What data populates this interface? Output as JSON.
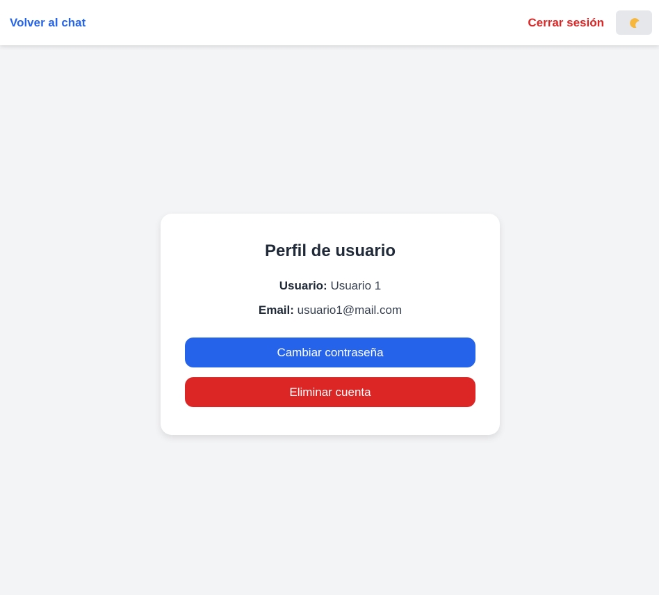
{
  "header": {
    "back_label": "Volver al chat",
    "logout_label": "Cerrar sesión",
    "theme_icon": "moon-icon"
  },
  "profile": {
    "title": "Perfil de usuario",
    "user_label": "Usuario:",
    "user_value": "Usuario 1",
    "email_label": "Email:",
    "email_value": "usuario1@mail.com",
    "change_password_label": "Cambiar contraseña",
    "delete_account_label": "Eliminar cuenta"
  },
  "colors": {
    "primary": "#2563eb",
    "danger": "#dc2626",
    "background": "#f3f4f6"
  }
}
